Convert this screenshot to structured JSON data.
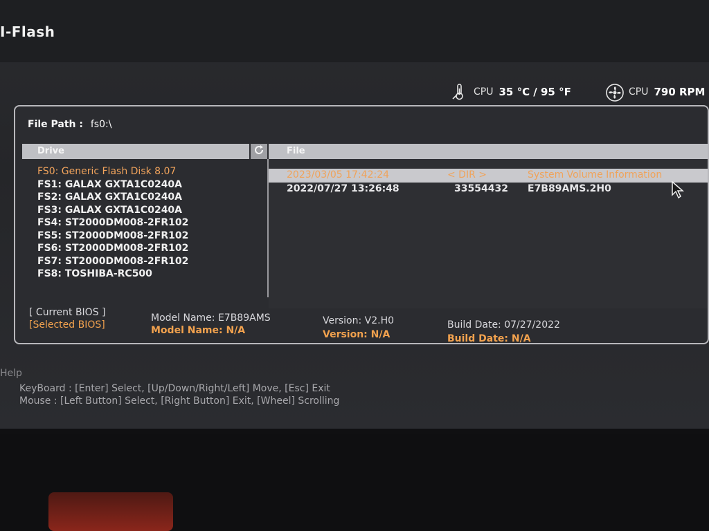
{
  "app": {
    "title": "I-Flash"
  },
  "status": {
    "cpu_temp_label": "CPU",
    "cpu_temp_value": "35 °C / 95 °F",
    "cpu_fan_label": "CPU",
    "cpu_fan_value": "790 RPM"
  },
  "file_path": {
    "label": "File Path :",
    "value": "fs0:\\"
  },
  "drive_panel": {
    "header": "Drive",
    "items": [
      {
        "label": "FS0: Generic Flash Disk 8.07"
      },
      {
        "label": "FS1: GALAX GXTA1C0240A"
      },
      {
        "label": "FS2: GALAX GXTA1C0240A"
      },
      {
        "label": "FS3: GALAX GXTA1C0240A"
      },
      {
        "label": "FS4: ST2000DM008-2FR102"
      },
      {
        "label": "FS5: ST2000DM008-2FR102"
      },
      {
        "label": "FS6: ST2000DM008-2FR102"
      },
      {
        "label": "FS7: ST2000DM008-2FR102"
      },
      {
        "label": "FS8: TOSHIBA-RC500"
      }
    ],
    "selected_index": 0
  },
  "file_panel": {
    "header": "File",
    "rows": [
      {
        "date": "2023/03/05 17:42:24",
        "size": "< DIR >",
        "name": "System Volume Information"
      },
      {
        "date": "2022/07/27 13:26:48",
        "size": "33554432",
        "name": "E7B89AMS.2H0"
      }
    ],
    "highlighted_index": 0
  },
  "bios": {
    "current_label": "[ Current BIOS ]",
    "selected_label": "[Selected BIOS]",
    "current": {
      "model": "Model Name: E7B89AMS",
      "version": "Version: V2.H0",
      "build": "Build Date: 07/27/2022"
    },
    "selected": {
      "model": "Model Name: N/A",
      "version": "Version: N/A",
      "build": "Build Date: N/A"
    }
  },
  "help": {
    "title": "Help",
    "keyboard": "KeyBoard :  [Enter] Select,   [Up/Down/Right/Left] Move,   [Esc] Exit",
    "mouse": "Mouse     :  [Left Button] Select,   [Right Button] Exit,   [Wheel] Scrolling"
  },
  "colors": {
    "accent": "#f2a24e",
    "header_bar": "#bfc0c4",
    "panel_border": "#b8b8bc"
  }
}
